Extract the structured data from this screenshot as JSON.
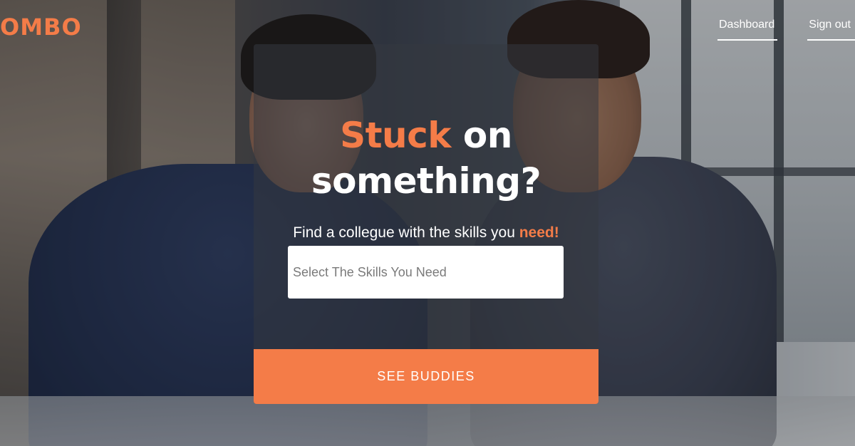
{
  "brand": {
    "logo_text": "OMBO",
    "accent_color": "#f47c48"
  },
  "nav": {
    "dashboard_label": "Dashboard",
    "signout_label": "Sign out"
  },
  "hero": {
    "headline_accent": "Stuck",
    "headline_rest_line1": " on",
    "headline_line2": "something?",
    "tagline_prefix": "Find a collegue with the skills you ",
    "tagline_accent": "need!",
    "skills_input": {
      "placeholder": "Select The Skills You Need",
      "value": ""
    },
    "cta_label": "SEE BUDDIES"
  }
}
